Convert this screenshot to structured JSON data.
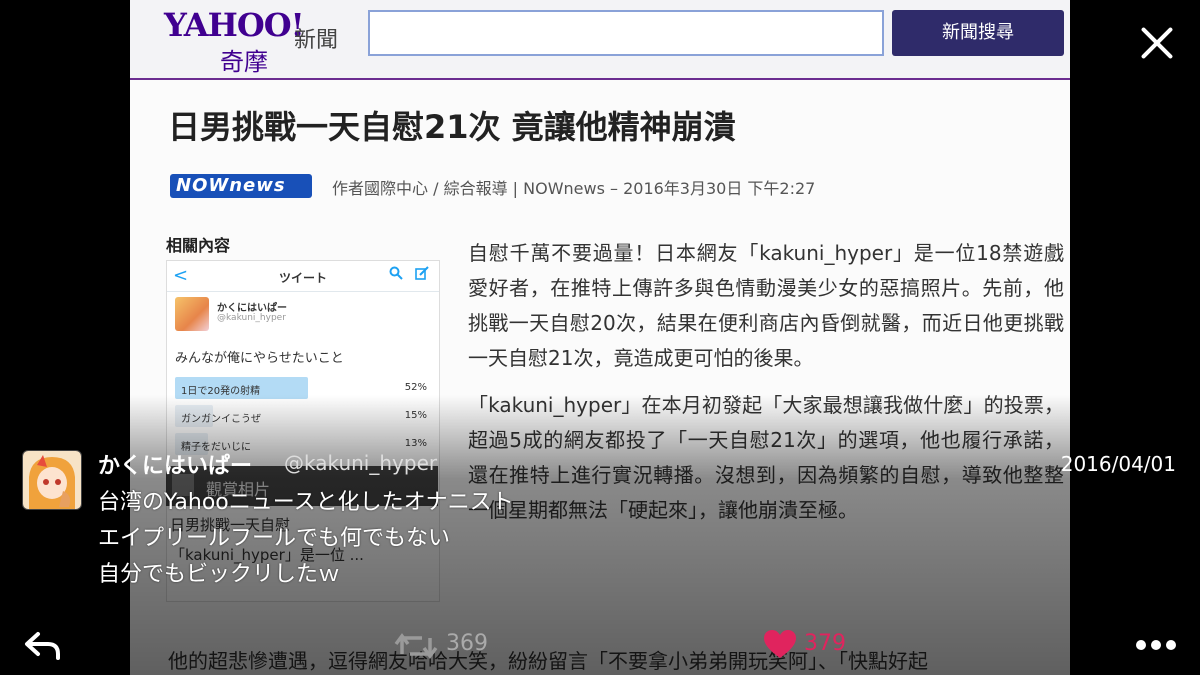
{
  "viewer": {
    "close_icon": "close-icon"
  },
  "photo": {
    "yahoo": {
      "logo_main": "YAHOO!",
      "logo_sub": "奇摩",
      "section": "新聞",
      "search_button": "新聞搜尋"
    },
    "headline": "日男挑戰一天自慰21次 竟讓他精神崩潰",
    "byline_logo": "NOWnews",
    "byline": "作者國際中心 / 綜合報導 | NOWnews – 2016年3月30日 下午2:27",
    "sidebar_heading": "相關內容",
    "embedded_tweet": {
      "back": "<",
      "title": "ツイート",
      "name": "かくにはいぱー",
      "handle": "@kakuni_hyper",
      "text": "みんなが俺にやらせたいこと",
      "poll": [
        {
          "label": "1日で20発の射精",
          "pct": "52%",
          "fill": 0.52
        },
        {
          "label": "ガンガンイこうぜ",
          "pct": "15%",
          "fill": 0.15
        },
        {
          "label": "精子をだいじに",
          "pct": "13%",
          "fill": 0.13
        }
      ]
    },
    "view_photo_label": "觀賞相片",
    "related_1": "日男挑戰一天自慰",
    "related_snippet": "「kakuni_hyper」是一位 ...",
    "article_paragraphs": [
      "自慰千萬不要過量！日本網友「kakuni_hyper」是一位18禁遊戲愛好者，在推特上傳許多與色情動漫美少女的惡搞照片。先前，他挑戰一天自慰20次，結果在便利商店內昏倒就醫，而近日他更挑戰一天自慰21次，竟造成更可怕的後果。",
      "「kakuni_hyper」在本月初發起「大家最想讓我做什麼」的投票，超過5成的網友都投了「一天自慰21次」的選項，他也履行承諾，還在推特上進行實況轉播。沒想到，因為頻繁的自慰，導致他整整一個星期都無法「硬起來」，讓他崩潰至極。"
    ],
    "footer_paragraph": "他的超悲慘遭遇，逗得網友哈哈大笑，紛紛留言「不要拿小弟弟開玩笑阿」、「快點好起"
  },
  "tweet": {
    "author_name": "かくにはいぱー",
    "author_handle": "@kakuni_hyper",
    "date": "2016/04/01",
    "lines": [
      "台湾のYahooニュースと化したオナニスト",
      "エイプリールフールでも何でもない",
      "自分でもビックリしたｗ"
    ]
  },
  "actions": {
    "reply_icon": "reply-icon",
    "retweet_icon": "retweet-icon",
    "retweet_count": "369",
    "like_icon": "heart-icon",
    "like_count": "379",
    "more_icon": "more-icon"
  },
  "colors": {
    "yahoo_purple": "#400090",
    "like_red": "#e0245e",
    "twitter_blue": "#1da1f2"
  }
}
